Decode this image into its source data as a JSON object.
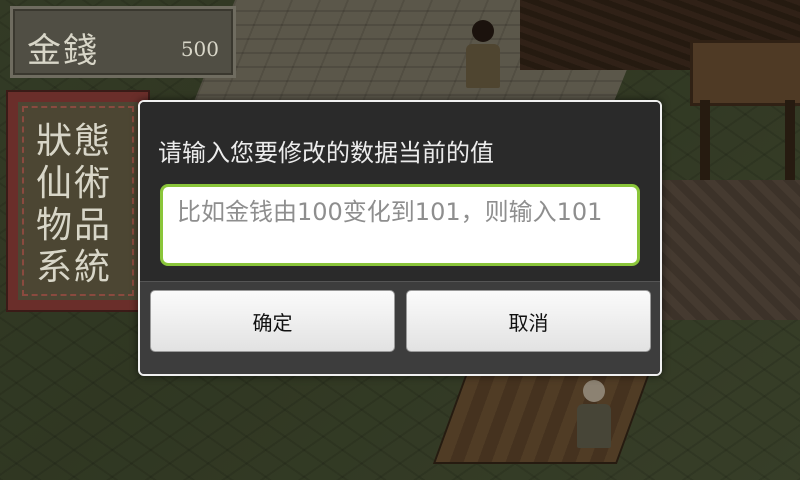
{
  "hud": {
    "gold_label": "金錢",
    "gold_value": "500",
    "menu": [
      "狀態",
      "仙術",
      "物品",
      "系統"
    ]
  },
  "dialog": {
    "message": "请输入您要修改的数据当前的值",
    "input_placeholder": "比如金钱由100变化到101，则输入101",
    "input_value": "",
    "ok_label": "确定",
    "cancel_label": "取消"
  },
  "colors": {
    "input_focus_border": "#8ac53a",
    "dialog_background": "#2b2b2b",
    "menu_frame": "#6a2e2a"
  }
}
